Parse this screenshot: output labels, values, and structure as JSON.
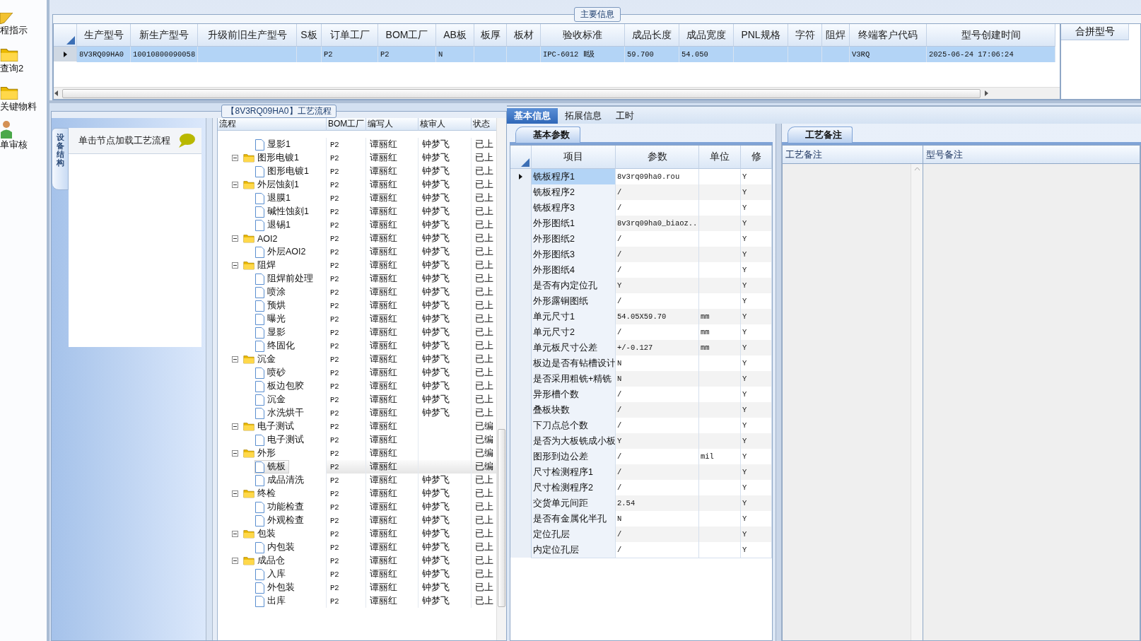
{
  "nav": [
    {
      "label": "程指示",
      "kind": "pencil"
    },
    {
      "label": "查询2",
      "kind": "folder"
    },
    {
      "label": "关键物料",
      "kind": "folder"
    },
    {
      "label": "单审核",
      "kind": "user"
    }
  ],
  "main_info": {
    "title": "主要信息",
    "columns": [
      "生产型号",
      "新生产型号",
      "升级前旧生产型号",
      "S板",
      "订单工厂",
      "BOM工厂",
      "AB板",
      "板厚",
      "板材",
      "验收标准",
      "成品长度",
      "成品宽度",
      "PNL规格",
      "字符",
      "阻焊",
      "终端客户代码",
      "型号创建时间"
    ],
    "rows": [
      {
        "selected": true,
        "cells": [
          "8V3RQ09HA0",
          "10010800090058",
          null,
          null,
          "P2",
          "P2",
          "N",
          null,
          null,
          "IPC-6012 Ⅱ级",
          "59.700",
          "54.050",
          null,
          null,
          null,
          "V3RQ",
          "2025-06-24 17:06:24"
        ]
      }
    ],
    "side_column": "合拼型号"
  },
  "flow": {
    "title": "【8V3RQ09HA0】工艺流程",
    "side_tab": "设备结构",
    "hint": "单击节点加载工艺流程",
    "columns": [
      "流程",
      "BOM工厂",
      "编写人",
      "核审人",
      "状态"
    ],
    "tree": [
      {
        "kind": "continued",
        "children": [
          {
            "kind": "step",
            "label": "显影1",
            "bom": "P2",
            "writer": "谭丽红",
            "reviewer": "钟梦飞",
            "status": "已上",
            "selected": false
          }
        ]
      },
      {
        "kind": "folder",
        "label": "图形电镀1",
        "bom": "P2",
        "writer": "谭丽红",
        "reviewer": "钟梦飞",
        "status": "已上",
        "selected": false,
        "expanded": true,
        "children": [
          {
            "kind": "step",
            "label": "图形电镀1",
            "bom": "P2",
            "writer": "谭丽红",
            "reviewer": "钟梦飞",
            "status": "已上",
            "selected": false
          }
        ]
      },
      {
        "kind": "folder",
        "label": "外层蚀刻1",
        "bom": "P2",
        "writer": "谭丽红",
        "reviewer": "钟梦飞",
        "status": "已上",
        "selected": false,
        "expanded": true,
        "children": [
          {
            "kind": "step",
            "label": "退膜1",
            "bom": "P2",
            "writer": "谭丽红",
            "reviewer": "钟梦飞",
            "status": "已上",
            "selected": false
          },
          {
            "kind": "step",
            "label": "碱性蚀刻1",
            "bom": "P2",
            "writer": "谭丽红",
            "reviewer": "钟梦飞",
            "status": "已上",
            "selected": false
          },
          {
            "kind": "step",
            "label": "退锡1",
            "bom": "P2",
            "writer": "谭丽红",
            "reviewer": "钟梦飞",
            "status": "已上",
            "selected": false
          }
        ]
      },
      {
        "kind": "folder",
        "label": "AOI2",
        "bom": "P2",
        "writer": "谭丽红",
        "reviewer": "钟梦飞",
        "status": "已上",
        "selected": false,
        "expanded": true,
        "children": [
          {
            "kind": "step",
            "label": "外层AOI2",
            "bom": "P2",
            "writer": "谭丽红",
            "reviewer": "钟梦飞",
            "status": "已上",
            "selected": false
          }
        ]
      },
      {
        "kind": "folder",
        "label": "阻焊",
        "bom": "P2",
        "writer": "谭丽红",
        "reviewer": "钟梦飞",
        "status": "已上",
        "selected": false,
        "expanded": true,
        "children": [
          {
            "kind": "step",
            "label": "阻焊前处理",
            "bom": "P2",
            "writer": "谭丽红",
            "reviewer": "钟梦飞",
            "status": "已上",
            "selected": false
          },
          {
            "kind": "step",
            "label": "喷涂",
            "bom": "P2",
            "writer": "谭丽红",
            "reviewer": "钟梦飞",
            "status": "已上",
            "selected": false
          },
          {
            "kind": "step",
            "label": "预烘",
            "bom": "P2",
            "writer": "谭丽红",
            "reviewer": "钟梦飞",
            "status": "已上",
            "selected": false
          },
          {
            "kind": "step",
            "label": "曝光",
            "bom": "P2",
            "writer": "谭丽红",
            "reviewer": "钟梦飞",
            "status": "已上",
            "selected": false
          },
          {
            "kind": "step",
            "label": "显影",
            "bom": "P2",
            "writer": "谭丽红",
            "reviewer": "钟梦飞",
            "status": "已上",
            "selected": false
          },
          {
            "kind": "step",
            "label": "终固化",
            "bom": "P2",
            "writer": "谭丽红",
            "reviewer": "钟梦飞",
            "status": "已上",
            "selected": false
          }
        ]
      },
      {
        "kind": "folder",
        "label": "沉金",
        "bom": "P2",
        "writer": "谭丽红",
        "reviewer": "钟梦飞",
        "status": "已上",
        "selected": false,
        "expanded": true,
        "children": [
          {
            "kind": "step",
            "label": "喷砂",
            "bom": "P2",
            "writer": "谭丽红",
            "reviewer": "钟梦飞",
            "status": "已上",
            "selected": false
          },
          {
            "kind": "step",
            "label": "板边包胶",
            "bom": "P2",
            "writer": "谭丽红",
            "reviewer": "钟梦飞",
            "status": "已上",
            "selected": false
          },
          {
            "kind": "step",
            "label": "沉金",
            "bom": "P2",
            "writer": "谭丽红",
            "reviewer": "钟梦飞",
            "status": "已上",
            "selected": false
          },
          {
            "kind": "step",
            "label": "水洗烘干",
            "bom": "P2",
            "writer": "谭丽红",
            "reviewer": "钟梦飞",
            "status": "已上",
            "selected": false
          }
        ]
      },
      {
        "kind": "folder",
        "label": "电子测试",
        "bom": "P2",
        "writer": "谭丽红",
        "status": "已编",
        "selected": false,
        "expanded": true,
        "children": [
          {
            "kind": "step",
            "label": "电子测试",
            "bom": "P2",
            "writer": "谭丽红",
            "status": "已编",
            "selected": false
          }
        ]
      },
      {
        "kind": "folder",
        "label": "外形",
        "bom": "P2",
        "writer": "谭丽红",
        "status": "已编",
        "selected": false,
        "expanded": true,
        "children": [
          {
            "kind": "step",
            "label": "铣板",
            "bom": "P2",
            "writer": "谭丽红",
            "status": "已编",
            "selected": true
          },
          {
            "kind": "step",
            "label": "成品清洗",
            "bom": "P2",
            "writer": "谭丽红",
            "reviewer": "钟梦飞",
            "status": "已上",
            "selected": false
          }
        ]
      },
      {
        "kind": "folder",
        "label": "终检",
        "bom": "P2",
        "writer": "谭丽红",
        "reviewer": "钟梦飞",
        "status": "已上",
        "selected": false,
        "expanded": true,
        "children": [
          {
            "kind": "step",
            "label": "功能检查",
            "bom": "P2",
            "writer": "谭丽红",
            "reviewer": "钟梦飞",
            "status": "已上",
            "selected": false
          },
          {
            "kind": "step",
            "label": "外观检查",
            "bom": "P2",
            "writer": "谭丽红",
            "reviewer": "钟梦飞",
            "status": "已上",
            "selected": false
          }
        ]
      },
      {
        "kind": "folder",
        "label": "包装",
        "bom": "P2",
        "writer": "谭丽红",
        "reviewer": "钟梦飞",
        "status": "已上",
        "selected": false,
        "expanded": true,
        "children": [
          {
            "kind": "step",
            "label": "内包装",
            "bom": "P2",
            "writer": "谭丽红",
            "reviewer": "钟梦飞",
            "status": "已上",
            "selected": false
          }
        ]
      },
      {
        "kind": "folder",
        "label": "成品仓",
        "bom": "P2",
        "writer": "谭丽红",
        "reviewer": "钟梦飞",
        "status": "已上",
        "selected": false,
        "expanded": true,
        "children": [
          {
            "kind": "step",
            "label": "入库",
            "bom": "P2",
            "writer": "谭丽红",
            "reviewer": "钟梦飞",
            "status": "已上",
            "selected": false
          },
          {
            "kind": "step",
            "label": "外包装",
            "bom": "P2",
            "writer": "谭丽红",
            "reviewer": "钟梦飞",
            "status": "已上",
            "selected": false
          },
          {
            "kind": "step",
            "label": "出库",
            "bom": "P2",
            "writer": "谭丽红",
            "reviewer": "钟梦飞",
            "status": "已上",
            "selected": false
          }
        ]
      }
    ]
  },
  "detail": {
    "tabs": [
      {
        "label": "基本信息",
        "selected": true
      },
      {
        "label": "拓展信息",
        "selected": false
      },
      {
        "label": "工时",
        "selected": false
      }
    ],
    "params": {
      "tab": "基本参数",
      "columns": [
        "项目",
        "参数",
        "单位",
        "修"
      ],
      "rows": [
        {
          "item": "铣板程序1",
          "value": "8v3rq09ha0.rou",
          "flag": "Y",
          "selected": true
        },
        {
          "item": "铣板程序2",
          "value": "/",
          "flag": "Y",
          "selected": false
        },
        {
          "item": "铣板程序3",
          "value": "/",
          "flag": "Y",
          "selected": false
        },
        {
          "item": "外形图纸1",
          "value": "8v3rq09ha0_biaoz...",
          "flag": "Y",
          "selected": false
        },
        {
          "item": "外形图纸2",
          "value": "/",
          "flag": "Y",
          "selected": false
        },
        {
          "item": "外形图纸3",
          "value": "/",
          "flag": "Y",
          "selected": false
        },
        {
          "item": "外形图纸4",
          "value": "/",
          "flag": "Y",
          "selected": false
        },
        {
          "item": "是否有内定位孔",
          "value": "Y",
          "flag": "Y",
          "selected": false
        },
        {
          "item": "外形露铜图纸",
          "value": "/",
          "flag": "Y",
          "selected": false
        },
        {
          "item": "单元尺寸1",
          "value": "54.05X59.70",
          "unit": "mm",
          "flag": "Y",
          "selected": false
        },
        {
          "item": "单元尺寸2",
          "value": "/",
          "unit": "mm",
          "flag": "Y",
          "selected": false
        },
        {
          "item": "单元板尺寸公差",
          "value": "+/-0.127",
          "unit": "mm",
          "flag": "Y",
          "selected": false
        },
        {
          "item": "板边是否有钻槽设计",
          "value": "N",
          "flag": "Y",
          "selected": false
        },
        {
          "item": "是否采用粗铣+精铣",
          "value": "N",
          "flag": "Y",
          "selected": false
        },
        {
          "item": "异形槽个数",
          "value": "/",
          "flag": "Y",
          "selected": false
        },
        {
          "item": "叠板块数",
          "value": "/",
          "flag": "Y",
          "selected": false
        },
        {
          "item": "下刀点总个数",
          "value": "/",
          "flag": "Y",
          "selected": false
        },
        {
          "item": "是否为大板铣成小板",
          "value": "Y",
          "flag": "Y",
          "selected": false
        },
        {
          "item": "图形到边公差",
          "value": "/",
          "unit": "mil",
          "flag": "Y",
          "selected": false
        },
        {
          "item": "尺寸检测程序1",
          "value": "/",
          "flag": "Y",
          "selected": false
        },
        {
          "item": "尺寸检测程序2",
          "value": "/",
          "flag": "Y",
          "selected": false
        },
        {
          "item": "交货单元间距",
          "value": "2.54",
          "flag": "Y",
          "selected": false
        },
        {
          "item": "是否有金属化半孔",
          "value": "N",
          "flag": "Y",
          "selected": false
        },
        {
          "item": "定位孔层",
          "value": "/",
          "flag": "Y",
          "selected": false
        },
        {
          "item": "内定位孔层",
          "value": "/",
          "flag": "Y",
          "selected": false
        }
      ]
    },
    "remarks": {
      "tab": "工艺备注",
      "columns": [
        "工艺备注",
        "型号备注"
      ]
    }
  }
}
